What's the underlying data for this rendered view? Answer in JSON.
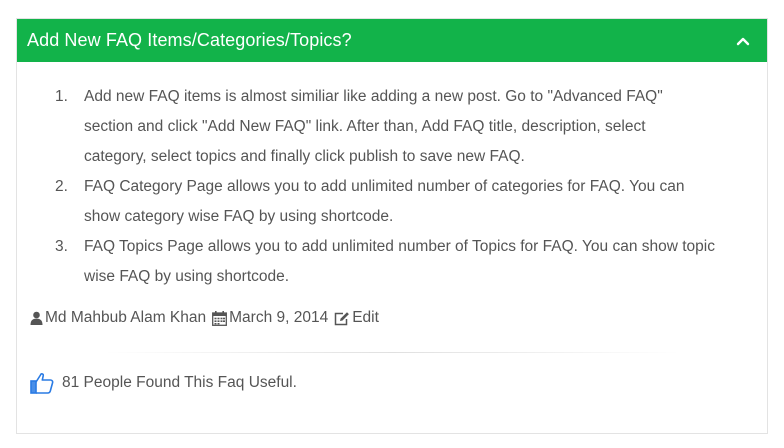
{
  "panel": {
    "title": "Add New FAQ Items/Categories/Topics?",
    "header_color": "#12b34a",
    "toggle_icon": "chevron-up-icon"
  },
  "faq_items": [
    {
      "number": "1.",
      "lines": [
        "Add new FAQ items is almost similiar like adding a new post. Go to \"Advanced FAQ\"",
        "section and click \"Add New FAQ\" link. After than, Add FAQ title, description, select",
        "category, select topics and finally click publish to save new FAQ."
      ]
    },
    {
      "number": "2.",
      "lines": [
        "FAQ Category Page allows you to add unlimited number of categories for FAQ. You can",
        "show category wise FAQ by using shortcode."
      ]
    },
    {
      "number": "3.",
      "lines": [
        "FAQ Topics Page allows you to add unlimited number of Topics for FAQ. You can show topic",
        "wise FAQ by using shortcode."
      ]
    }
  ],
  "meta": {
    "author": "Md Mahbub Alam Khan",
    "date": "March 9, 2014",
    "edit_label": "Edit",
    "author_icon": "user-icon",
    "date_icon": "calendar-icon",
    "edit_icon": "edit-icon"
  },
  "useful": {
    "text": "81 People Found This Faq Useful.",
    "icon": "thumbs-up-icon",
    "icon_color": "#2a7be4"
  }
}
